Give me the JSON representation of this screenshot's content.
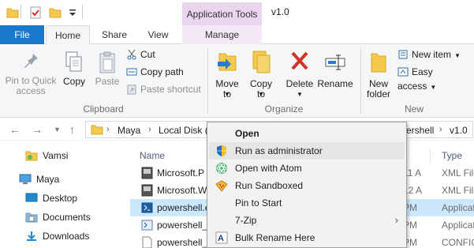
{
  "title_bar": {
    "context_tab_header": "Application Tools",
    "window_title": "v1.0"
  },
  "tabs": {
    "file": "File",
    "home": "Home",
    "share": "Share",
    "view": "View",
    "manage": "Manage"
  },
  "ribbon": {
    "clipboard": {
      "label": "Clipboard",
      "pin_to_quick_access": "Pin to Quick access",
      "copy": "Copy",
      "paste": "Paste",
      "cut": "Cut",
      "copy_path": "Copy path",
      "paste_shortcut": "Paste shortcut"
    },
    "organize": {
      "label": "Organize",
      "move_to": "Move to",
      "copy_to": "Copy to",
      "delete": "Delete",
      "rename": "Rename"
    },
    "new": {
      "label": "New",
      "new_folder": "New folder",
      "new_item": "New item",
      "easy_access": "Easy access"
    }
  },
  "address_bar": {
    "crumbs": [
      "Maya",
      "Local Disk (",
      "ershell",
      "v1.0"
    ]
  },
  "nav_pane": {
    "items": [
      "Vamsi",
      "Maya",
      "Desktop",
      "Documents",
      "Downloads"
    ]
  },
  "file_list": {
    "columns": {
      "name": "Name",
      "type": "Type"
    },
    "rows": [
      {
        "name": "Microsoft.P",
        "date": "11 A",
        "type": "XML File"
      },
      {
        "name": "Microsoft.W",
        "date": "12 A",
        "type": "XML File"
      },
      {
        "name": "powershell.e",
        "date": "PM",
        "type": "Applicat"
      },
      {
        "name": "powershell_",
        "date": "PM",
        "type": "Applicat"
      },
      {
        "name": "powershell_",
        "date": "PM",
        "type": "CONFIG"
      }
    ]
  },
  "context_menu": {
    "items": [
      {
        "label": "Open",
        "icon": "none"
      },
      {
        "label": "Run as administrator",
        "icon": "uac-shield-icon"
      },
      {
        "label": "Open with Atom",
        "icon": "atom-icon"
      },
      {
        "label": "Run Sandboxed",
        "icon": "sandbox-icon"
      },
      {
        "label": "Pin to Start",
        "icon": "none"
      },
      {
        "label": "7-Zip",
        "icon": "none",
        "submenu": true
      },
      {
        "label": "Bulk Rename Here",
        "icon": "bulk-rename-icon"
      }
    ]
  },
  "colors": {
    "file_tab": "#1979ca",
    "context_tab": "#e9d6ee",
    "selection": "#cce8ff",
    "menu_hover": "#e5e5e5"
  }
}
